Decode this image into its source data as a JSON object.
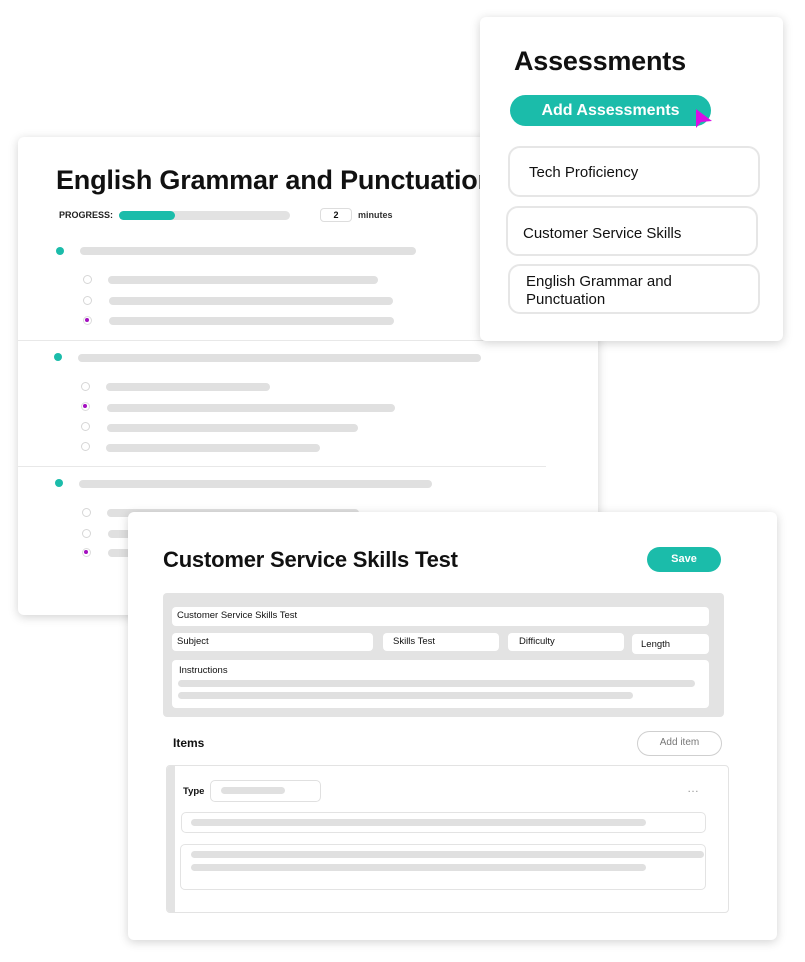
{
  "grammar_card": {
    "title": "English Grammar and Punctuation",
    "progress_label": "PROGRESS:",
    "progress_percent": 33,
    "minutes_value": "2",
    "minutes_label": "minutes",
    "questions": [
      {
        "options": [
          false,
          false,
          true
        ]
      },
      {
        "options": [
          false,
          true,
          false,
          false
        ]
      },
      {
        "options": [
          false,
          false,
          true
        ]
      }
    ]
  },
  "assessments_card": {
    "title": "Assessments",
    "add_button_label": "Add Assessments",
    "items": [
      {
        "label": "Tech Proficiency"
      },
      {
        "label": "Customer Service Skills"
      },
      {
        "label": "English Grammar and Punctuation"
      }
    ]
  },
  "customer_service_card": {
    "title": "Customer Service Skills Test",
    "save_label": "Save",
    "fields": {
      "name": "Customer Service Skills Test",
      "subject": "Subject",
      "type": "Skills Test",
      "difficulty": "Difficulty",
      "length": "Length",
      "instructions": "Instructions"
    },
    "items_label": "Items",
    "add_item_label": "Add item",
    "item": {
      "type_label": "Type",
      "more_icon": "…"
    }
  },
  "colors": {
    "accent": "#1bbcaa",
    "selected_radio": "#a40fc0",
    "cursor": "#d90ee6",
    "placeholder_bar": "#e0e0e0"
  }
}
